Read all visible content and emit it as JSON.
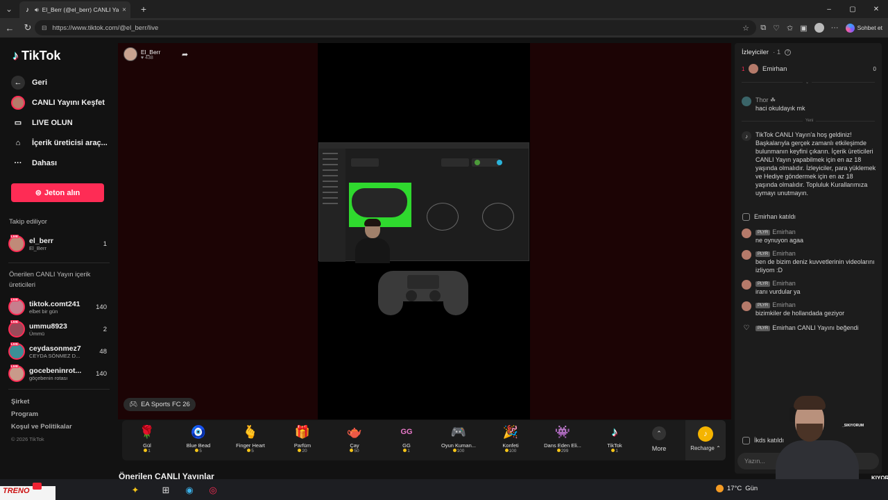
{
  "browser": {
    "tab_title": "El_Berr (@el_berr) CANLI Yayın",
    "tab_close": "×",
    "new_tab": "+",
    "url": "https://www.tiktok.com/@el_berr/live",
    "copilot_label": "Sohbet et",
    "win_min": "–",
    "win_max": "▢",
    "win_close": "✕"
  },
  "sidebar": {
    "logo": "TikTok",
    "nav": [
      {
        "label": "Geri",
        "icon": "back-arrow-icon"
      },
      {
        "label": "CANLI Yayını Keşfet",
        "icon": "live-avatar-icon"
      },
      {
        "label": "LIVE OLUN",
        "icon": "camera-icon"
      },
      {
        "label": "İçerik üreticisi araç...",
        "icon": "home-icon"
      },
      {
        "label": "Dahası",
        "icon": "more-dots-icon"
      }
    ],
    "coin_button": "Jeton alın",
    "following_title": "Takip ediliyor",
    "following": [
      {
        "name": "el_berr",
        "sub": "El_Berr",
        "count": "1"
      }
    ],
    "recommended_title": "Önerilen CANLI Yayın içerik üreticileri",
    "recommended": [
      {
        "name": "tiktok.comt241",
        "sub": "elbet bir gün",
        "count": "140"
      },
      {
        "name": "ummu8923",
        "sub": "Ümmü",
        "count": "2"
      },
      {
        "name": "ceydasonmez7",
        "sub": "CEYDA SÖNMEZ D...",
        "count": "48"
      },
      {
        "name": "gocebeninrot...",
        "sub": "göçebenin rotası",
        "count": "140"
      }
    ],
    "footer": [
      "Şirket",
      "Program",
      "Koşul ve Politikalar"
    ],
    "copyright": "© 2026 TikTok"
  },
  "stream": {
    "host_name": "El_Berr",
    "host_likes": "♥ 438",
    "game_tag": "EA Sports FC 26"
  },
  "gifts": [
    {
      "name": "Gül",
      "price": "1",
      "emoji": "🌹"
    },
    {
      "name": "Blue Bead",
      "price": "5",
      "emoji": "🧿"
    },
    {
      "name": "Finger Heart",
      "price": "5",
      "emoji": "🫰"
    },
    {
      "name": "Parfüm",
      "price": "20",
      "emoji": "🎁"
    },
    {
      "name": "Çay",
      "price": "50",
      "emoji": "🫖"
    },
    {
      "name": "GG",
      "price": "1",
      "emoji": "GG"
    },
    {
      "name": "Oyun Kuman...",
      "price": "100",
      "emoji": "🎮"
    },
    {
      "name": "Konfeti",
      "price": "100",
      "emoji": "🎉"
    },
    {
      "name": "Dans Eden Eli...",
      "price": "299",
      "emoji": "👾"
    },
    {
      "name": "TikTok",
      "price": "1",
      "emoji": "♪"
    }
  ],
  "more_label": "More",
  "recharge_label": "Recharge ⌃",
  "recommended_streams_heading": "Önerilen CANLI Yayınlar",
  "chat": {
    "viewers_title": "İzleyiciler",
    "viewers_count": "· 1",
    "top_viewer": {
      "rank": "1",
      "name": "Emirhan",
      "score": "0"
    },
    "older": [
      {
        "user": "Thor ☘",
        "text": "haci okuldayık mk"
      }
    ],
    "new_label": "Yeni",
    "welcome": "TikTok CANLI Yayın'a hoş geldiniz! Başkalarıyla gerçek zamanlı etkileşimde bulunmanın keyfini çıkarın. İçerik üreticileri CANLI Yayın yapabilmek için en az 18 yaşında olmalıdır. İzleyiciler, para yüklemek ve Hediye göndermek için en az 18 yaşında olmalıdır. Topluluk Kurallarımıza uymayı unutmayın.",
    "join_msg": "Emirhan katıldı",
    "badge": "PLYR",
    "messages": [
      {
        "user": "Emirhan",
        "text": "ne oynuyon agaa"
      },
      {
        "user": "Emirhan",
        "text": "ben de bizim deniz kuvvetlerinin videolarını izliyom :D"
      },
      {
        "user": "Emirhan",
        "text": "iranı vurdular ya"
      },
      {
        "user": "Emirhan",
        "text": "bizimkiler de hollandada geziyor"
      }
    ],
    "like_msg": "Emirhan CANLI Yayını beğendi",
    "join_msg2": "İkds katıldı",
    "input_placeholder": "Yazın..."
  },
  "webcam": {
    "tag": "_SIKIYORUM",
    "caption": "KIYOR"
  },
  "taskbar": {
    "logo": "TRENO",
    "weather": "17°C",
    "weather_tail": "Gün"
  }
}
